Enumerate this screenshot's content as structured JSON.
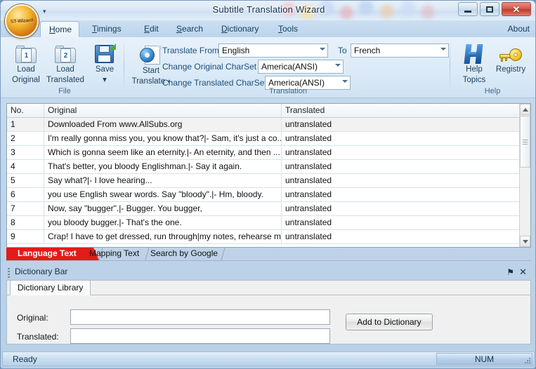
{
  "window": {
    "title": "Subtitle Translation Wizard",
    "orb_label": "ST-Wizard",
    "qat_caret": "▾",
    "minimize_name": "minimize",
    "maximize_name": "maximize",
    "close_name": "close"
  },
  "tabs": {
    "items": [
      {
        "label": "Home",
        "accel": "H",
        "active": true
      },
      {
        "label": "Timings",
        "accel": "T",
        "active": false
      },
      {
        "label": "Edit",
        "accel": "E",
        "active": false
      },
      {
        "label": "Search",
        "accel": "S",
        "active": false
      },
      {
        "label": "Dictionary",
        "accel": "D",
        "active": false
      },
      {
        "label": "Tools",
        "accel": "T",
        "active": false
      }
    ],
    "about": "About"
  },
  "ribbon": {
    "groups": [
      {
        "name": "file",
        "title": "File"
      },
      {
        "name": "translation",
        "title": "Translation"
      },
      {
        "name": "help",
        "title": "Help"
      }
    ],
    "file": {
      "load_original": "Load\nOriginal",
      "load_original_l1": "Load",
      "load_original_l2": "Original",
      "load_translated_l1": "Load",
      "load_translated_l2": "Translated",
      "save_l1": "Save",
      "save_caret": "▾",
      "badge_original": "1",
      "badge_translated": "2"
    },
    "translation": {
      "start_l1": "Start",
      "start_l2": "Translate",
      "start_caret": "▾",
      "label_from": "Translate From",
      "label_to": "To",
      "label_orig_charset": "Change Original CharSet",
      "label_trans_charset": "Change Translated CharSet",
      "value_from": "English",
      "value_to": "French",
      "value_orig_charset": "America(ANSI)",
      "value_trans_charset": "America(ANSI)"
    },
    "help": {
      "help_topics_l1": "Help",
      "help_topics_l2": "Topics",
      "registry_l1": "Registry"
    }
  },
  "grid": {
    "columns": [
      "No.",
      "Original",
      "Translated"
    ],
    "rows": [
      {
        "no": "1",
        "original": "Downloaded From www.AllSubs.org",
        "translated": "untranslated"
      },
      {
        "no": "2",
        "original": "I'm really gonna miss you, you know that?|- Sam, it's just a co...",
        "translated": "untranslated"
      },
      {
        "no": "3",
        "original": "Which is gonna seem like an eternity.|- An eternity, and then ...",
        "translated": "untranslated"
      },
      {
        "no": "4",
        "original": "That's better, you bloody Englishman.|- Say it again.",
        "translated": "untranslated"
      },
      {
        "no": "5",
        "original": "Say what?|- I love hearing...",
        "translated": "untranslated"
      },
      {
        "no": "6",
        "original": "you use English swear words. Say \"bloody\".|- Hm, bloody.",
        "translated": "untranslated"
      },
      {
        "no": "7",
        "original": "Now, say \"bugger\".|- Bugger. You bugger,",
        "translated": "untranslated"
      },
      {
        "no": "8",
        "original": "you bloody bugger.|- That's the one.",
        "translated": "untranslated"
      },
      {
        "no": "9",
        "original": "Crap! I have to get dressed, run through|my notes, rehearse m...",
        "translated": "untranslated"
      }
    ]
  },
  "bottom_tabs": {
    "items": [
      {
        "label": "Language Text",
        "selected": true
      },
      {
        "label": "Mapping Text",
        "selected": false
      },
      {
        "label": "Search by Google",
        "selected": false
      }
    ],
    "selected_color": "#e21b1b"
  },
  "dictionary_bar": {
    "title": "Dictionary Bar",
    "pin_icon": "⚑",
    "close_icon": "✕",
    "library_tab": "Dictionary Library",
    "original_label": "Original:",
    "translated_label": "Translated:",
    "original_value": "",
    "translated_value": "",
    "add_button": "Add to Dictionary"
  },
  "status": {
    "ready": "Ready",
    "num": "NUM"
  }
}
